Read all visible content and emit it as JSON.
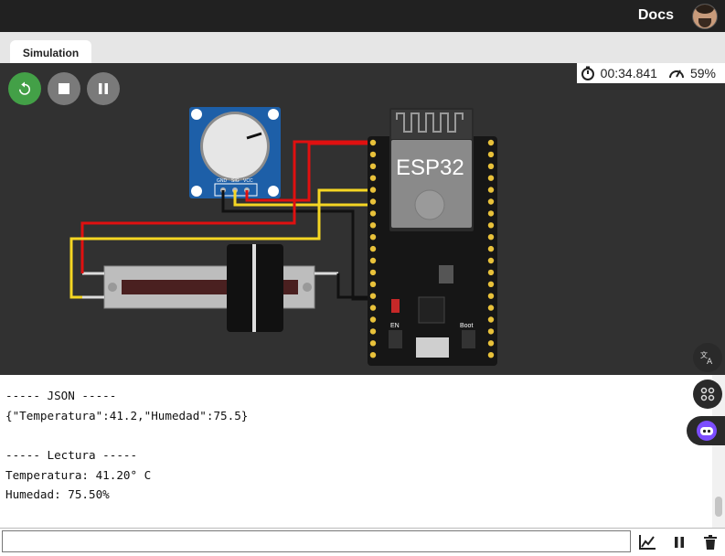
{
  "header": {
    "docs_label": "Docs",
    "avatar_icon": "user-avatar"
  },
  "tabs": [
    {
      "label": "Simulation"
    }
  ],
  "toolbar": {
    "restart_icon": "restart-icon",
    "stop_icon": "stop-icon",
    "pause_icon": "pause-icon"
  },
  "status": {
    "timer": "00:34.841",
    "speed": "59%"
  },
  "board": {
    "label": "ESP32",
    "en_label": "EN",
    "boot_label": "Boot"
  },
  "sensor": {
    "pin_labels": [
      "GND",
      "SIG",
      "VCC"
    ]
  },
  "console": {
    "lines": [
      "----- JSON -----",
      "{\"Temperatura\":41.2,\"Humedad\":75.5}",
      "",
      "----- Lectura -----",
      "Temperatura: 41.20° C",
      "Humedad: 75.50%"
    ]
  },
  "serial_input": {
    "value": "",
    "placeholder": ""
  },
  "colors": {
    "accent_green": "#43a047",
    "wire_red": "#e01010",
    "wire_yellow": "#f5d623",
    "wire_black": "#111111",
    "canvas_bg": "#313131"
  }
}
